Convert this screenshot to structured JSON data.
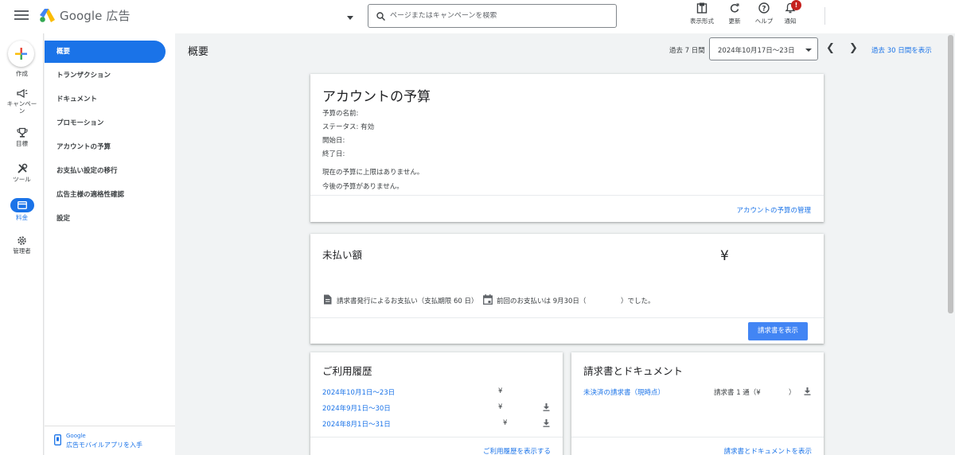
{
  "app": {
    "name": "Google 広告"
  },
  "search": {
    "placeholder": "ページまたはキャンペーンを検索"
  },
  "top_actions": [
    {
      "label": "表示形式",
      "icon": "display-format-icon"
    },
    {
      "label": "更新",
      "icon": "refresh-icon"
    },
    {
      "label": "ヘルプ",
      "icon": "help-icon"
    },
    {
      "label": "通知",
      "icon": "bell-icon"
    }
  ],
  "notification_badge": "!",
  "rail": {
    "create": "作成",
    "campaigns": "キャンペーン",
    "goals": "目標",
    "tools": "ツール",
    "billing": "料金",
    "admin": "管理者"
  },
  "sidenav": {
    "items": [
      "概要",
      "トランザクション",
      "ドキュメント",
      "プロモーション",
      "アカウントの予算",
      "お支払い設定の移行",
      "広告主様の適格性確認",
      "設定"
    ],
    "footer_small": "Google",
    "footer_link": "広告モバイルアプリを入手"
  },
  "header": {
    "title": "概要",
    "range_label": "過去 7 日間",
    "date_range": "2024年10月17日〜23日",
    "show_30": "過去 30 日間を表示"
  },
  "budget": {
    "title": "アカウントの予算",
    "name_label": "予算の名前:",
    "status": "ステータス: 有効",
    "start": "開始日:",
    "end": "終了日:",
    "note1": "現在の予算に上限はありません。",
    "note2": "今後の予算がありません。",
    "manage": "アカウントの予算の管理"
  },
  "unpaid": {
    "title": "未払い額",
    "amount": "¥",
    "method": "請求書発行によるお支払い（支払期限 60 日）",
    "last_payment_prefix": "前回のお支払いは 9月30日（",
    "last_payment_suffix": "）でした。",
    "view_invoice": "請求書を表示"
  },
  "history": {
    "title": "ご利用履歴",
    "rows": [
      {
        "period": "2024年10月1日〜23日",
        "amount": "¥"
      },
      {
        "period": "2024年9月1日〜30日",
        "amount": "¥"
      },
      {
        "period": "2024年8月1日〜31日",
        "amount": "¥"
      }
    ],
    "show_all": "ご利用履歴を表示する"
  },
  "docs": {
    "title": "請求書とドキュメント",
    "unsettled": "未決済の請求書（現時点）",
    "count_prefix": "請求書 1 通（¥",
    "count_suffix": "）",
    "show_all": "請求書とドキュメントを表示"
  },
  "colors": {
    "accent": "#1a73e8",
    "button": "#4285f4",
    "badge": "#c5221f"
  }
}
